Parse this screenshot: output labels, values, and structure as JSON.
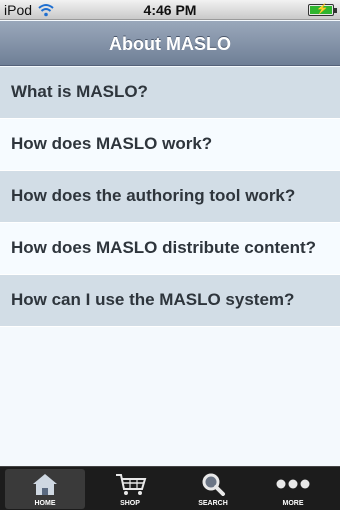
{
  "status_bar": {
    "carrier": "iPod",
    "time": "4:46 PM"
  },
  "nav": {
    "title": "About MASLO"
  },
  "items": [
    {
      "label": "What is MASLO?"
    },
    {
      "label": "How does MASLO work?"
    },
    {
      "label": "How does the authoring tool work?"
    },
    {
      "label": "How does MASLO distribute content?"
    },
    {
      "label": "How can I use the MASLO system?"
    }
  ],
  "tabs": [
    {
      "label": "HOME",
      "icon": "home-icon",
      "active": true
    },
    {
      "label": "SHOP",
      "icon": "cart-icon",
      "active": false
    },
    {
      "label": "SEARCH",
      "icon": "search-icon",
      "active": false
    },
    {
      "label": "MORE",
      "icon": "more-icon",
      "active": false
    }
  ],
  "colors": {
    "nav_bar": "#7f8ea4",
    "row_shaded": "#d2dde6",
    "row_plain": "#f6fbff",
    "tab_bar": "#1c1c1c",
    "battery": "#2fb52f"
  }
}
